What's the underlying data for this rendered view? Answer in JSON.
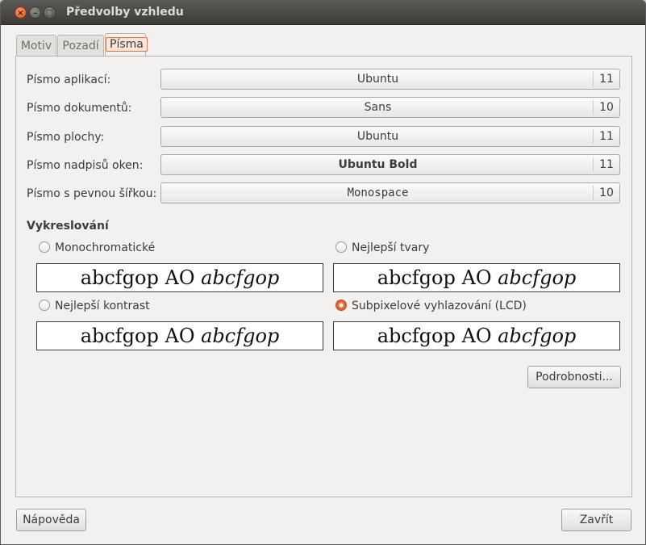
{
  "window": {
    "title": "Předvolby vzhledu",
    "close_glyph": "×",
    "minimize_glyph": "–",
    "maximize_glyph": "□"
  },
  "tabs": [
    {
      "label": "Motiv",
      "selected": false
    },
    {
      "label": "Pozadí",
      "selected": false
    },
    {
      "label": "Písma",
      "selected": true
    }
  ],
  "fonts": [
    {
      "label": "Písmo aplikací:",
      "name": "Ubuntu",
      "size": "11"
    },
    {
      "label": "Písmo dokumentů:",
      "name": "Sans",
      "size": "10"
    },
    {
      "label": "Písmo plochy:",
      "name": "Ubuntu",
      "size": "11"
    },
    {
      "label": "Písmo nadpisů oken:",
      "name": "Ubuntu Bold",
      "size": "11"
    },
    {
      "label": "Písmo s pevnou šířkou:",
      "name": "Monospace",
      "size": "10"
    }
  ],
  "rendering": {
    "heading": "Vykreslování",
    "sample_regular": "abcfgop AO ",
    "sample_italic": "abcfgop",
    "options": [
      {
        "label": "Monochromatické",
        "selected": false
      },
      {
        "label": "Nejlepší tvary",
        "selected": false
      },
      {
        "label": "Nejlepší kontrast",
        "selected": false
      },
      {
        "label": "Subpixelové vyhlazování (LCD)",
        "selected": true
      }
    ]
  },
  "buttons": {
    "details": "Podrobnosti...",
    "help": "Nápověda",
    "close": "Zavřít"
  },
  "colors": {
    "accent": "#e9733d",
    "titlebar": "#3d3c38",
    "background": "#f2f1f0"
  }
}
